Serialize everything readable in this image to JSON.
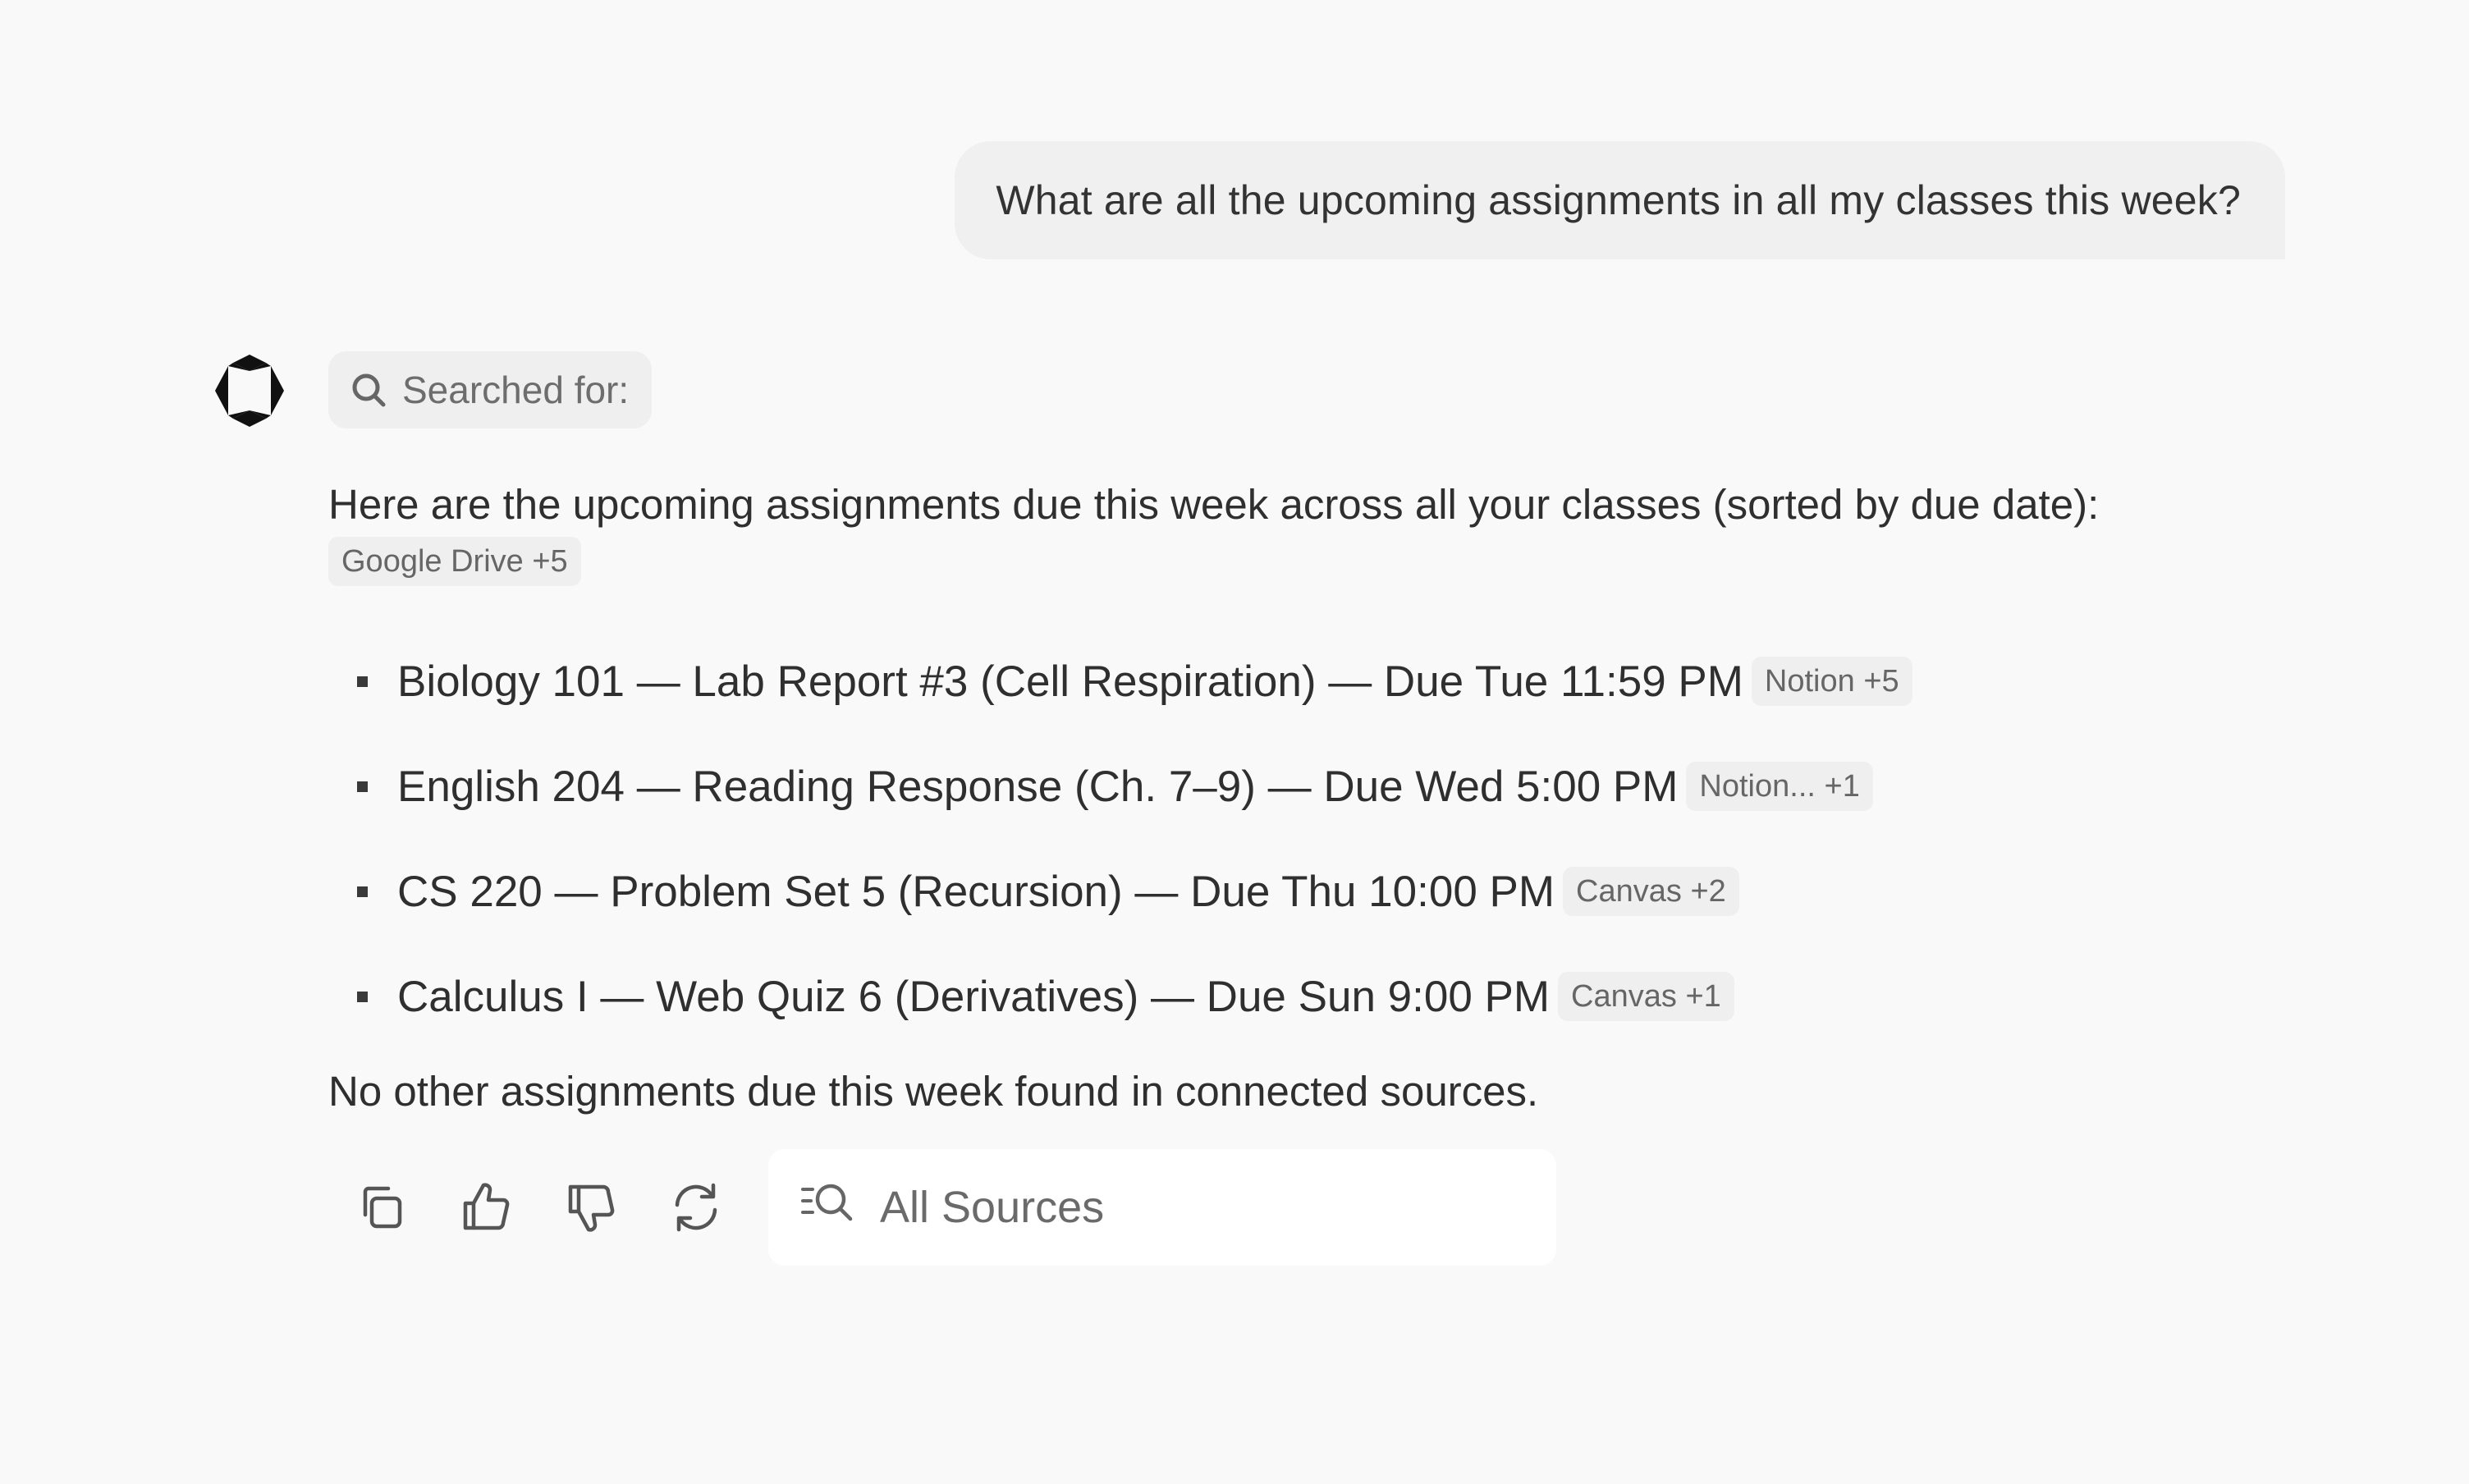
{
  "user_message": {
    "text": "What are all the upcoming assignments in all my classes this week?"
  },
  "assistant": {
    "avatar_icon": "assistant-logo-icon",
    "search_chip": {
      "icon": "search-icon",
      "label": "Searched for:"
    },
    "intro": "Here are the upcoming assignments due this week across all your classes (sorted by due date):",
    "intro_source": "Google Drive +5",
    "assignments": [
      {
        "text": "Biology 101 — Lab Report #3 (Cell Respiration) — Due Tue 11:59 PM",
        "source": "Notion +5"
      },
      {
        "text": "English 204 — Reading Response (Ch. 7–9) — Due Wed 5:00 PM",
        "source": "Notion... +1"
      },
      {
        "text": "CS 220 — Problem Set 5 (Recursion) — Due Thu 10:00 PM",
        "source": "Canvas +2"
      },
      {
        "text": "Calculus I — Web Quiz 6 (Derivatives) — Due Sun 9:00 PM",
        "source": "Canvas +1"
      }
    ],
    "closing": "No other assignments due this week found in connected sources."
  },
  "actions": {
    "icons": [
      "copy-icon",
      "thumbs-up-icon",
      "thumbs-down-icon",
      "regenerate-icon"
    ],
    "sources_box": {
      "icon": "search-sources-icon",
      "label": "All Sources"
    }
  },
  "colors": {
    "background": "#f9f9f9",
    "bubble": "#f0f0f0",
    "chip": "#efefef",
    "text": "#2f2f2f",
    "muted": "#6a6a6a"
  }
}
